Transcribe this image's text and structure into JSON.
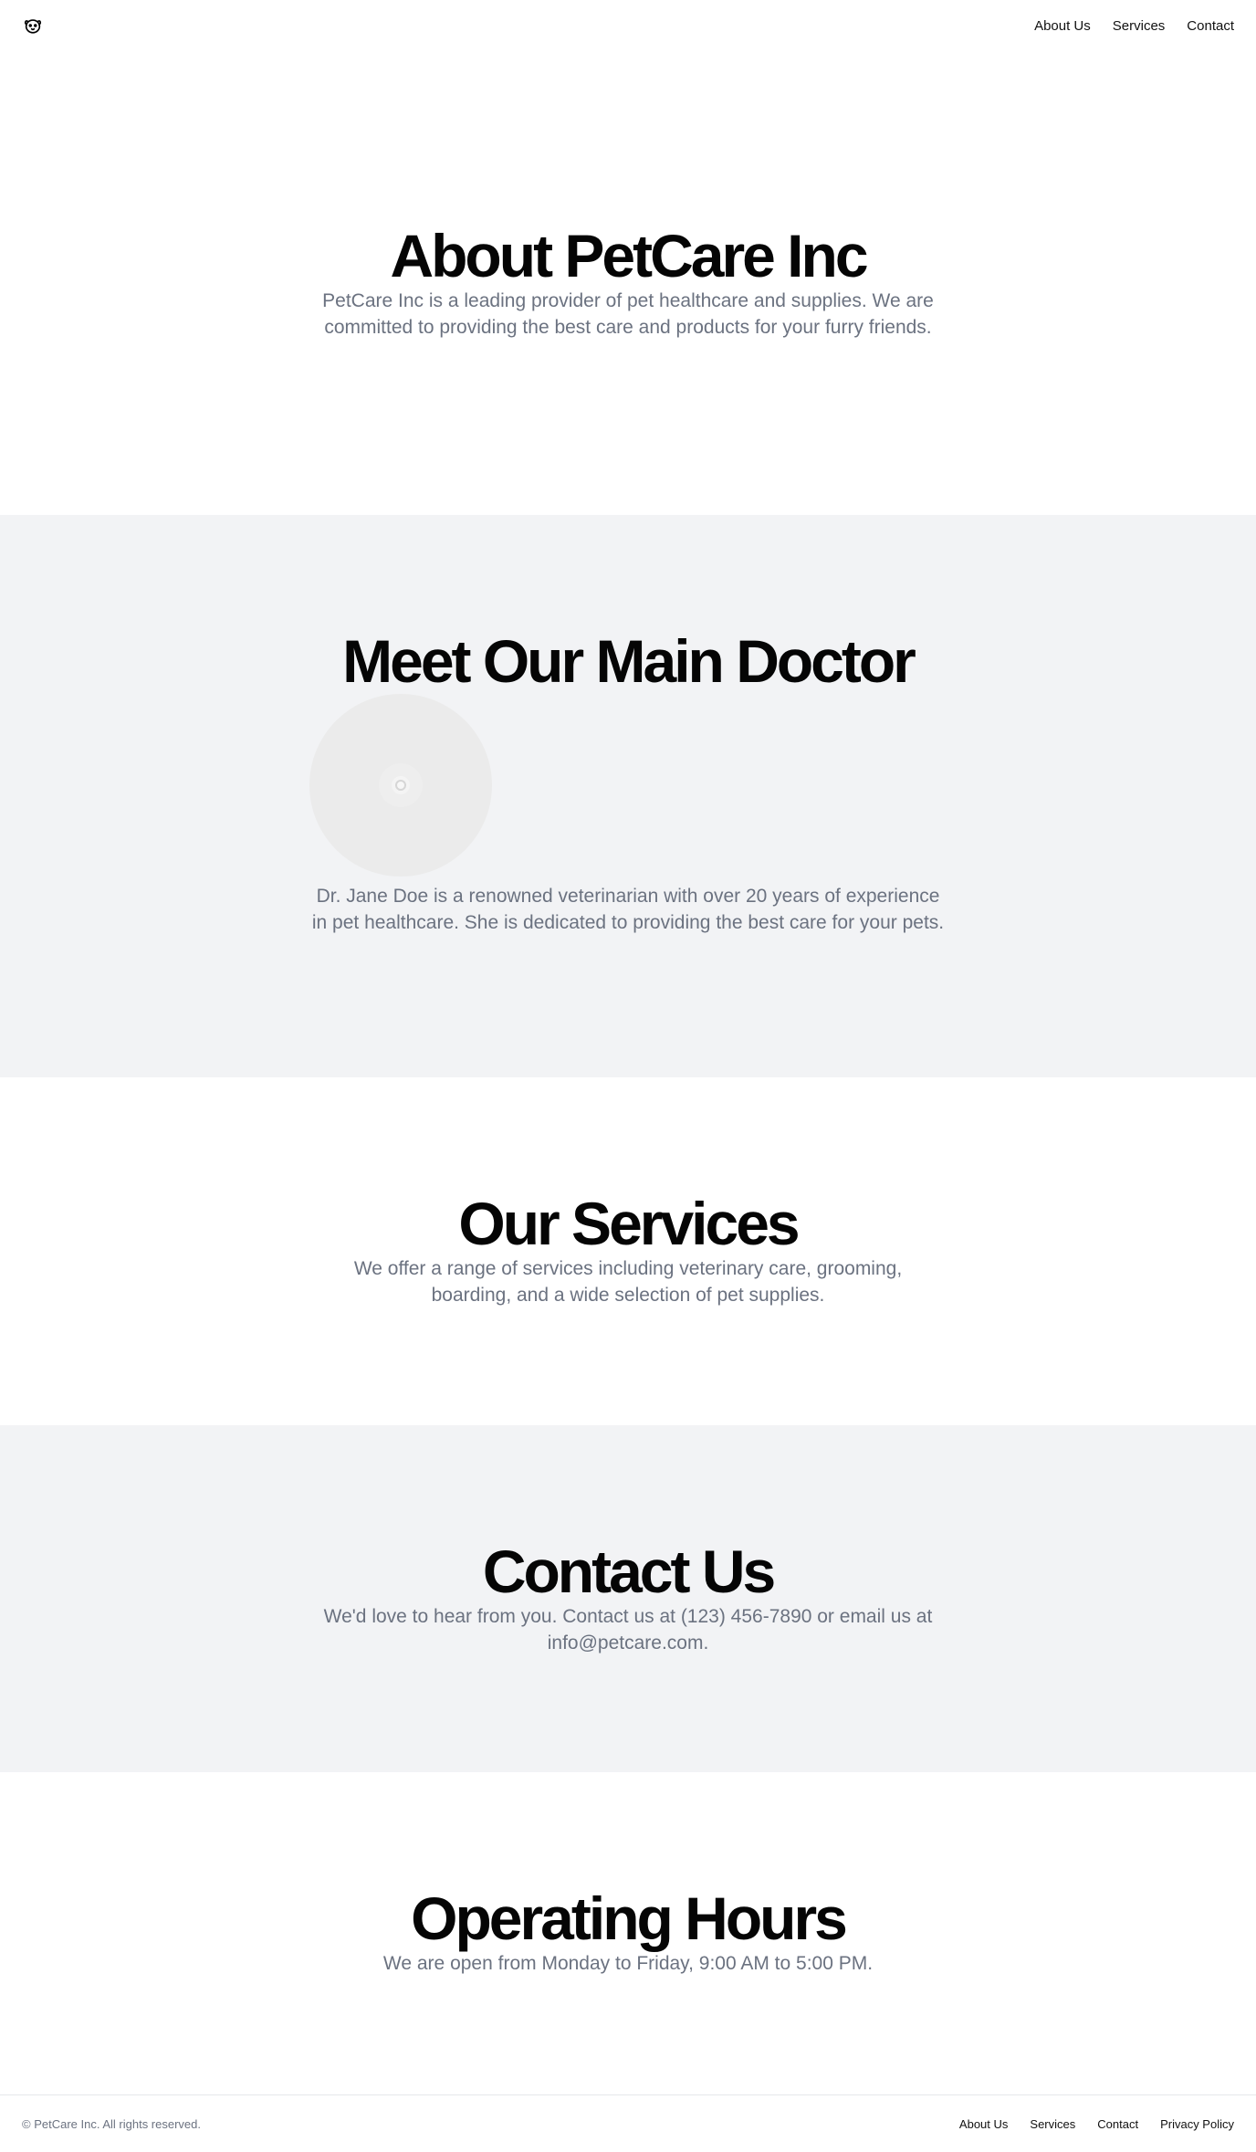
{
  "header": {
    "logo_icon": "paw-face-icon",
    "nav": [
      {
        "label": "About Us"
      },
      {
        "label": "Services"
      },
      {
        "label": "Contact"
      }
    ]
  },
  "about": {
    "title": "About PetCare Inc",
    "text": "PetCare Inc is a leading provider of pet healthcare and supplies. We are committed to providing the best care and products for your furry friends."
  },
  "doctor": {
    "title": "Meet Our Main Doctor",
    "image_icon": "image-placeholder-icon",
    "text": "Dr. Jane Doe is a renowned veterinarian with over 20 years of experience in pet healthcare. She is dedicated to providing the best care for your pets."
  },
  "services": {
    "title": "Our Services",
    "text": "We offer a range of services including veterinary care, grooming, boarding, and a wide selection of pet supplies."
  },
  "contact": {
    "title": "Contact Us",
    "text": "We'd love to hear from you. Contact us at (123) 456-7890 or email us at info@petcare.com."
  },
  "hours": {
    "title": "Operating Hours",
    "text": "We are open from Monday to Friday, 9:00 AM to 5:00 PM."
  },
  "footer": {
    "copyright": "© PetCare Inc. All rights reserved.",
    "links": [
      {
        "label": "About Us"
      },
      {
        "label": "Services"
      },
      {
        "label": "Contact"
      },
      {
        "label": "Privacy Policy"
      }
    ]
  },
  "colors": {
    "section_gray": "#f2f3f5",
    "body_text": "#6b7280",
    "heading": "#050505"
  }
}
